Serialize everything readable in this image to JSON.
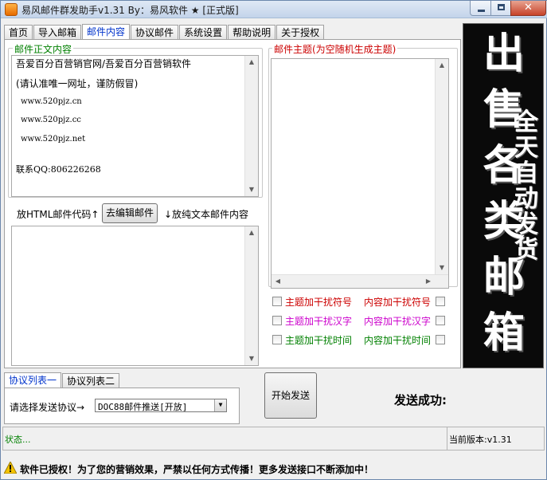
{
  "window": {
    "title": "易风邮件群发助手v1.31 By：易风软件 ★ [正式版]"
  },
  "tabs": [
    "首页",
    "导入邮箱",
    "邮件内容",
    "协议邮件",
    "系统设置",
    "帮助说明",
    "关于授权"
  ],
  "active_tab": "邮件内容",
  "body_group": {
    "label": "邮件正文内容",
    "lines": [
      "吾爱百分百营销官网/吾爱百分百营销软件",
      "(请认准唯一网址，谨防假冒)",
      "www.520pjz.cn",
      "www.520pjz.cc",
      "www.520pjz.net",
      "联系QQ:806226268"
    ]
  },
  "html_toolbar": {
    "html_label": "放HTML邮件代码↑",
    "edit_button": "去编辑邮件",
    "text_label": "↓放纯文本邮件内容"
  },
  "subject_group": {
    "label": "邮件主题(为空随机生成主题)"
  },
  "checkboxes": [
    {
      "label": "主题加干扰符号",
      "color": "#cc0000"
    },
    {
      "label": "内容加干扰符号",
      "color": "#cc0000"
    },
    {
      "label": "主题加干扰汉字",
      "color": "#cc00cc"
    },
    {
      "label": "内容加干扰汉字",
      "color": "#cc00cc"
    },
    {
      "label": "主题加干扰时间",
      "color": "#008000"
    },
    {
      "label": "内容加干扰时间",
      "color": "#008000"
    }
  ],
  "ad": {
    "big": [
      "出",
      "售",
      "各",
      "类",
      "邮",
      "箱"
    ],
    "small": [
      "全",
      "天",
      "自",
      "动",
      "发",
      "货"
    ]
  },
  "protocol_tabs": [
    "协议列表一",
    "协议列表二"
  ],
  "protocol": {
    "label": "请选择发送协议→",
    "selected": "DOC88邮件推送[开放]"
  },
  "send_button": "开始发送",
  "send_result": "发送成功:",
  "status": {
    "text": "状态...",
    "version": "当前版本:v1.31"
  },
  "warning": "软件已授权！为了您的营销效果，严禁以任何方式传播！更多发送接口不断添加中！",
  "colors": {
    "accent_blue": "#0033cc",
    "status_green": "#008000",
    "group_red": "#cc0000"
  }
}
